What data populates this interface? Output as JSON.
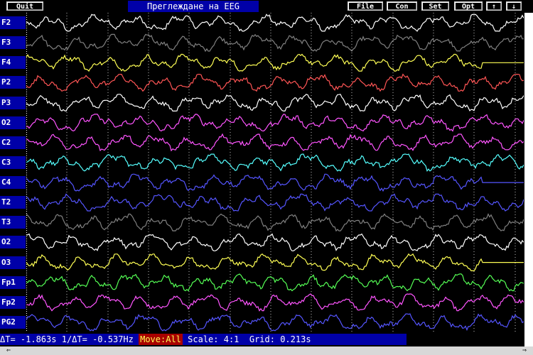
{
  "toolbar": {
    "quit": "Quit",
    "file": "File",
    "con": "Con",
    "set": "Set",
    "opt": "Opt",
    "up_arrow": "↑",
    "down_arrow": "↓"
  },
  "title": "Преглеждане на EEG",
  "channels": [
    {
      "label": "F2",
      "color": "#ffffff"
    },
    {
      "label": "F3",
      "color": "#808080"
    },
    {
      "label": "F4",
      "color": "#ffff55"
    },
    {
      "label": "P2",
      "color": "#ff5555"
    },
    {
      "label": "P3",
      "color": "#ffffff"
    },
    {
      "label": "O2",
      "color": "#ff55ff"
    },
    {
      "label": "C2",
      "color": "#ff55ff"
    },
    {
      "label": "C3",
      "color": "#55ffff"
    },
    {
      "label": "C4",
      "color": "#5555ff"
    },
    {
      "label": "T2",
      "color": "#5555ff"
    },
    {
      "label": "T3",
      "color": "#808080"
    },
    {
      "label": "O2",
      "color": "#ffffff"
    },
    {
      "label": "O3",
      "color": "#ffff55"
    },
    {
      "label": "Fp1",
      "color": "#55ff55"
    },
    {
      "label": "Fp2",
      "color": "#ff55ff"
    },
    {
      "label": "PG2",
      "color": "#5555ff"
    }
  ],
  "status": {
    "delta_t": "ΔT= -1.863s",
    "inv_delta_t": "1/ΔT= -0.537Hz",
    "move": "Move:All",
    "scale": "Scale: 4:1",
    "grid": "Grid: 0.213s"
  },
  "scroll": {
    "left_arrow": "⇐",
    "right_arrow": "⇒"
  }
}
